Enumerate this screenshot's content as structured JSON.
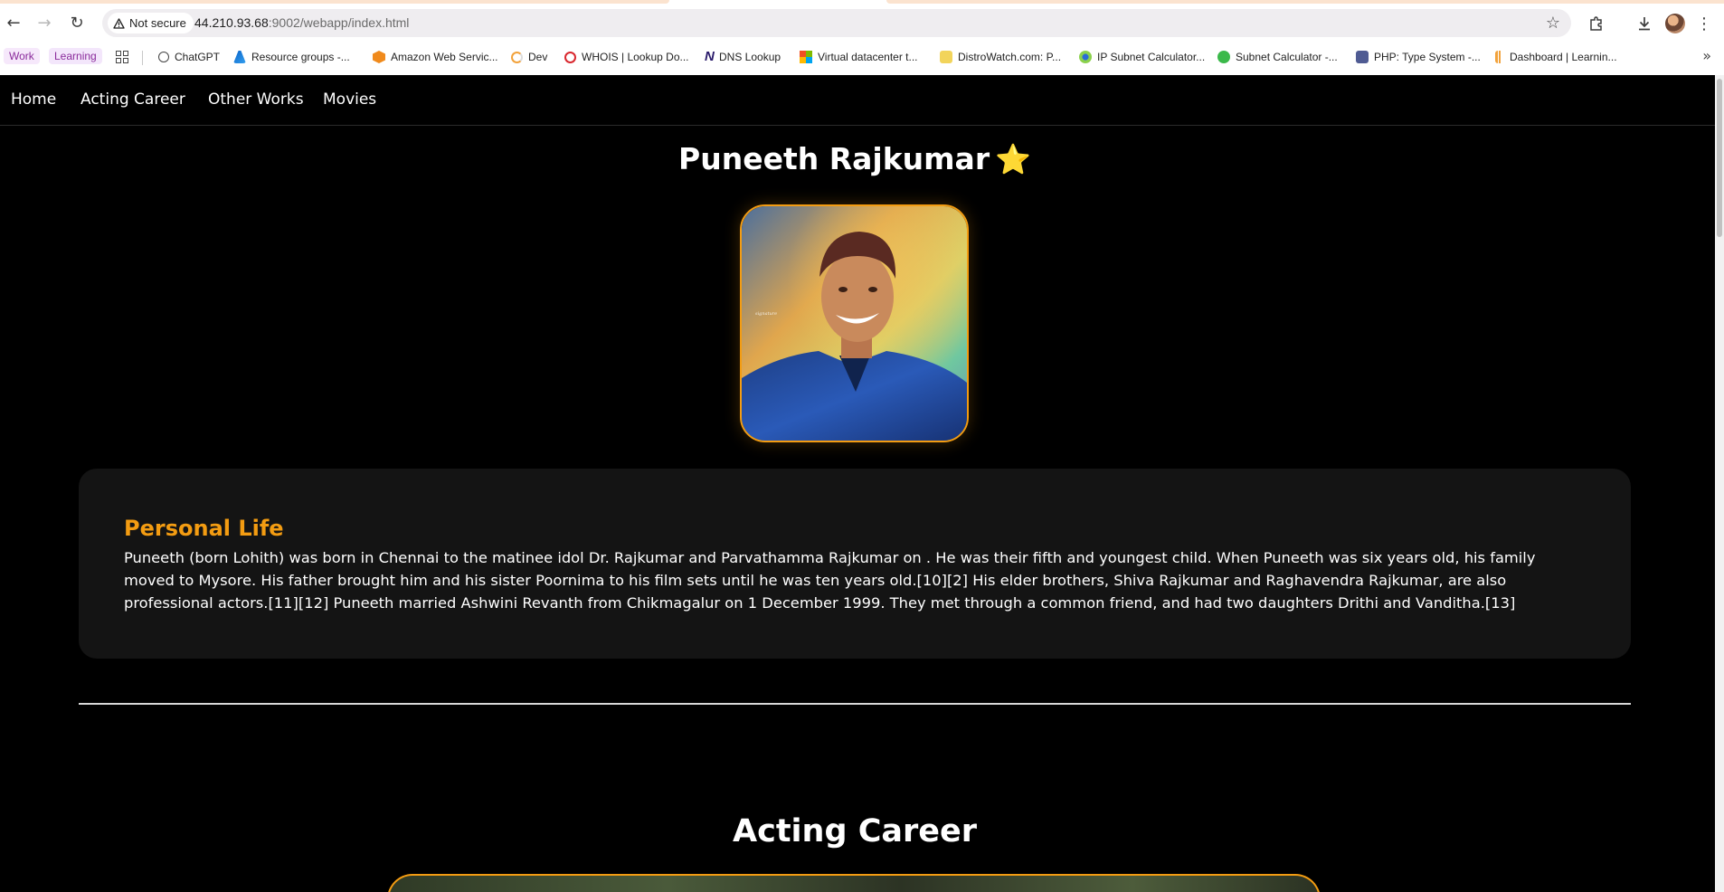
{
  "browser": {
    "security_label": "Not secure",
    "url_host": "44.210.93.68",
    "url_rest": ":9002/webapp/index.html",
    "bookmarks": [
      {
        "label": "Work",
        "icon": "chip"
      },
      {
        "label": "Learning",
        "icon": "chip"
      },
      {
        "label": "ChatGPT",
        "icon": "chatgpt-icon"
      },
      {
        "label": "Resource groups -...",
        "icon": "azure-icon"
      },
      {
        "label": "Amazon Web Servic...",
        "icon": "aws-icon"
      },
      {
        "label": "Dev",
        "icon": "dev-icon"
      },
      {
        "label": "WHOIS | Lookup Do...",
        "icon": "whois-icon"
      },
      {
        "label": "DNS Lookup",
        "icon": "dns-icon"
      },
      {
        "label": "Virtual datacenter t...",
        "icon": "microsoft-icon"
      },
      {
        "label": "DistroWatch.com: P...",
        "icon": "distrowatch-icon"
      },
      {
        "label": "IP Subnet Calculator...",
        "icon": "ip-calc-icon"
      },
      {
        "label": "Subnet Calculator -...",
        "icon": "subnet-icon"
      },
      {
        "label": "PHP: Type System -...",
        "icon": "php-icon"
      },
      {
        "label": "Dashboard | Learnin...",
        "icon": "dashboard-icon"
      }
    ],
    "colors": {
      "accent_chip_text": "#8a2b9b",
      "chrome_bg": "#ffffff",
      "omnibox_bg": "#efedf0"
    }
  },
  "site": {
    "nav": {
      "home": "Home",
      "acting_career": "Acting Career",
      "other_works": "Other Works",
      "movies": "Movies"
    },
    "hero": {
      "name": "Puneeth Rajkumar",
      "emoji": "⭐"
    },
    "personal_life": {
      "heading": "Personal Life",
      "body": "Puneeth (born Lohith) was born in Chennai to the matinee idol Dr. Rajkumar and Parvathamma Rajkumar on . He was their fifth and youngest child. When Puneeth was six years old, his family moved to Mysore. His father brought him and his sister Poornima to his film sets until he was ten years old.[10][2] His elder brothers, Shiva Rajkumar and Raghavendra Rajkumar, are also professional actors.[11][12] Puneeth married Ashwini Revanth from Chikmagalur on 1 December 1999. They met through a common friend, and had two daughters Drithi and Vanditha.[13]"
    },
    "acting_section": {
      "title": "Acting Career"
    },
    "colors": {
      "accent": "#f39c12",
      "background": "#000000",
      "card": "#141414"
    }
  }
}
